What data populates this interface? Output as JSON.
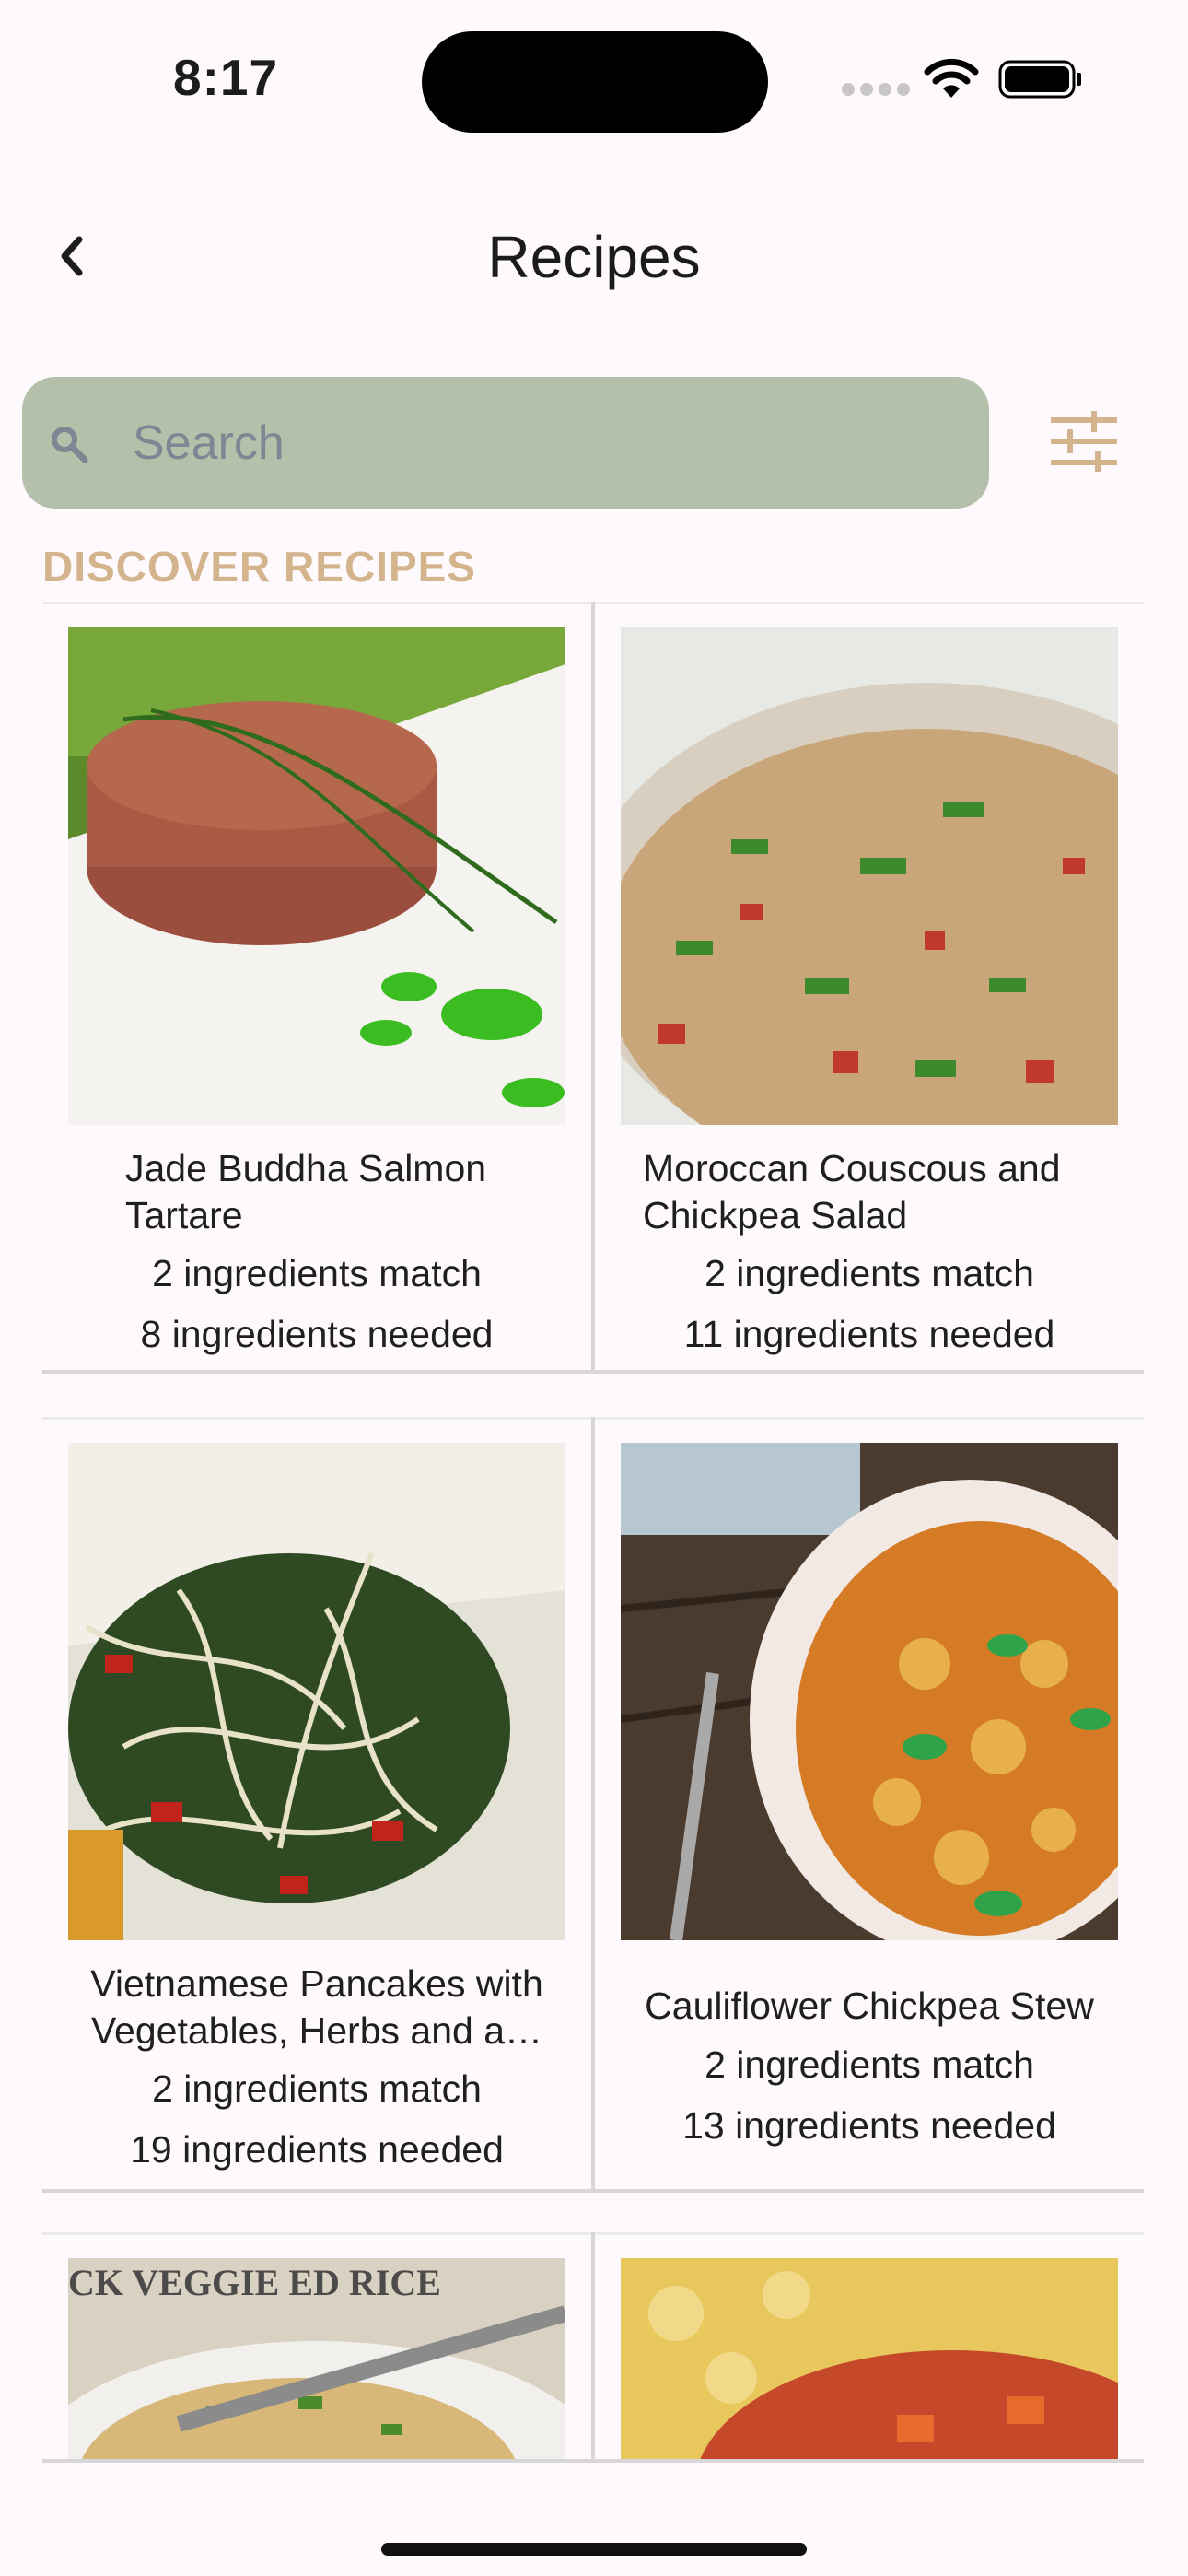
{
  "status": {
    "time": "8:17"
  },
  "nav": {
    "title": "Recipes"
  },
  "search": {
    "placeholder": "Search"
  },
  "section_title": "DISCOVER RECIPES",
  "recipes": [
    {
      "name": "Jade Buddha Salmon Tartare",
      "match": "2 ingredients match",
      "needed": "8 ingredients needed"
    },
    {
      "name": "Moroccan Couscous and Chickpea Salad",
      "match": "2 ingredients match",
      "needed": "11 ingredients needed"
    },
    {
      "name": "Vietnamese Pancakes with Vegetables, Herbs and a…",
      "match": "2 ingredients match",
      "needed": "19 ingredients needed"
    },
    {
      "name": "Cauliflower Chickpea Stew",
      "match": "2 ingredients match",
      "needed": "13 ingredients needed"
    },
    {
      "image_text": "CK VEGGIE ED RICE"
    },
    {}
  ],
  "colors": {
    "accent": "#d3b48d",
    "search_bg": "#b5c0aa",
    "background": "#fdf9fc"
  }
}
